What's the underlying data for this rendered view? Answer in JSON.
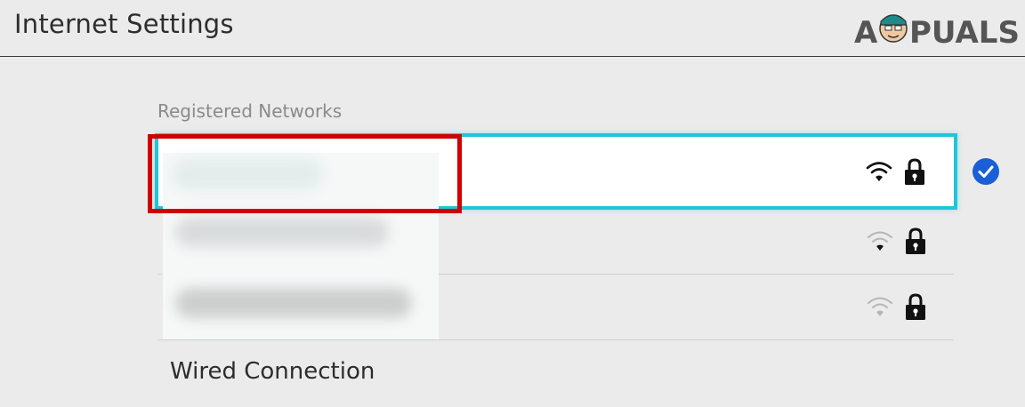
{
  "header": {
    "title": "Internet Settings",
    "logo_text": "APPUALS"
  },
  "registered_networks": {
    "section_label": "Registered Networks",
    "items": [
      {
        "name_visible": false,
        "signal": "strong",
        "locked": true,
        "selected": true,
        "connected": true
      },
      {
        "name_visible": false,
        "signal": "weak",
        "locked": true,
        "selected": false,
        "connected": false
      },
      {
        "name_visible": false,
        "signal": "weak",
        "locked": true,
        "selected": false,
        "connected": false
      }
    ],
    "wired_label": "Wired Connection"
  },
  "colors": {
    "background": "#ebebeb",
    "selection_border": "#1fc6d6",
    "check_badge": "#1a5fd6",
    "annotation_box": "#d10000",
    "wifi_weak": "#b5b5b5",
    "icon_dark": "#111111"
  },
  "icons": {
    "wifi": "wifi-icon",
    "lock": "lock-icon",
    "connected": "checkmark-icon"
  }
}
